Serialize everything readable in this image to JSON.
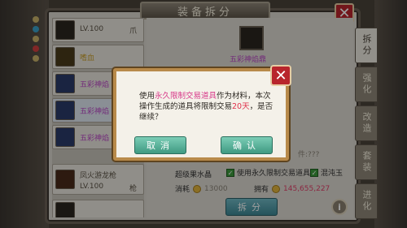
{
  "window": {
    "title": "装备拆分"
  },
  "tabs": [
    {
      "label": "拆分"
    },
    {
      "label": "强化"
    },
    {
      "label": "改造"
    },
    {
      "label": "套装"
    },
    {
      "label": "进化"
    }
  ],
  "list_items": [
    {
      "name": "",
      "lv": "LV.100",
      "kind": "爪"
    },
    {
      "name": "嗜血",
      "lv": "",
      "kind": ""
    },
    {
      "name": "五彩神焰",
      "lv": "",
      "kind": ""
    },
    {
      "name": "五彩神焰",
      "lv": "",
      "kind": ""
    },
    {
      "name": "五彩神焰",
      "lv": "",
      "kind": ""
    },
    {
      "name": "凤火游龙枪",
      "lv": "LV.100",
      "kind": "枪"
    },
    {
      "name": "",
      "lv": "",
      "kind": ""
    }
  ],
  "result": {
    "name": "五彩神焰鼎"
  },
  "material": {
    "label": "超级果水晶"
  },
  "options": {
    "use_limited": "使用永久限制交易道具",
    "chaos_jade": "混沌玉"
  },
  "cost": {
    "cost_label": "消耗",
    "cost_value": "13000",
    "owned_label": "拥有",
    "owned_value": "145,655,227"
  },
  "faded_text": "件:???",
  "buttons": {
    "dismantle": "拆分",
    "info": "i",
    "close": "✕"
  },
  "dialog": {
    "msg_part1": "使用",
    "msg_hl1": "永久限制交易道具",
    "msg_part2": "作为材料，本次操作生成的道具将限制交易",
    "msg_hl2": "20天",
    "msg_part3": "，是否继续？",
    "cancel": "取消",
    "confirm": "确认",
    "close": "✕"
  },
  "colors": {
    "highlight_pink": "#d83a8a",
    "highlight_red": "#e0304a",
    "button_teal": "#3f9a82",
    "close_red": "#b8252c"
  }
}
